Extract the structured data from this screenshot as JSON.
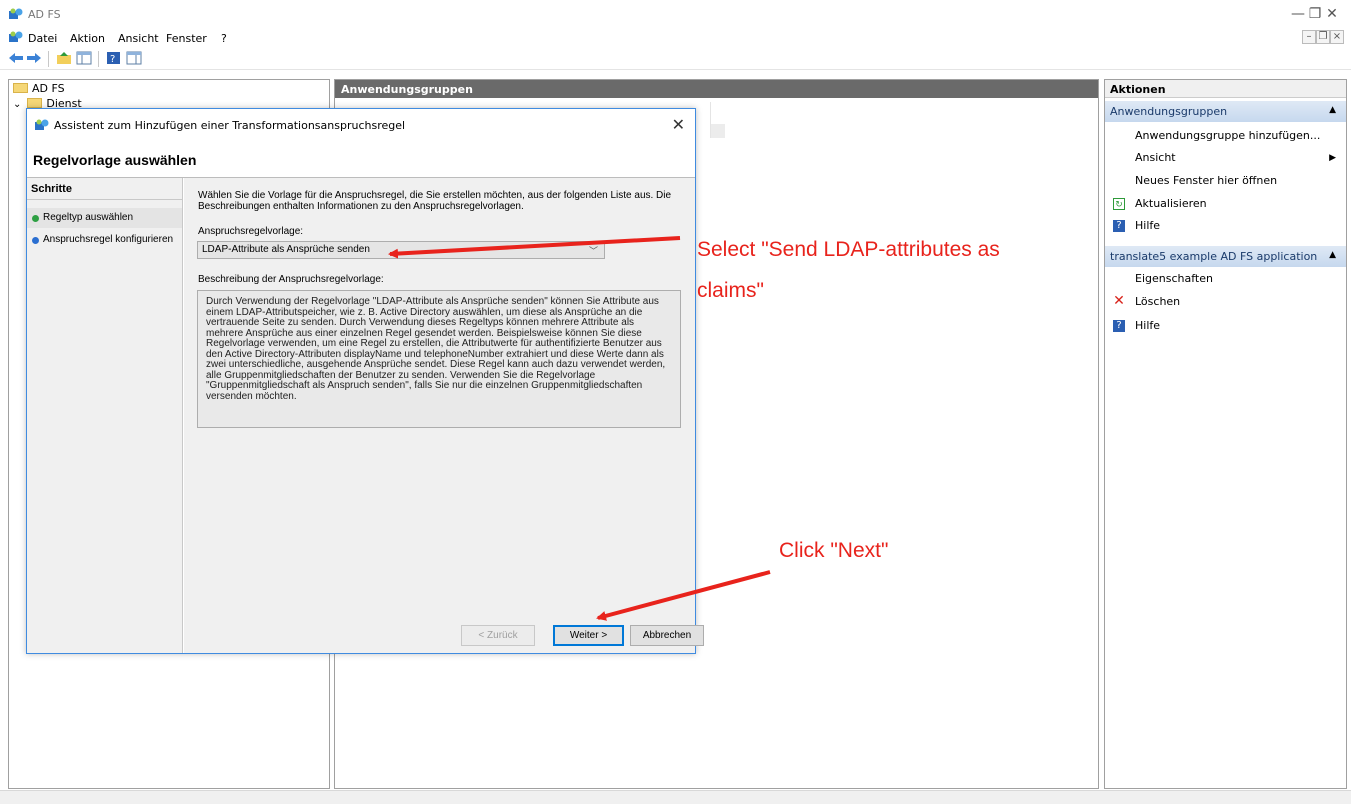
{
  "window": {
    "title": "AD FS"
  },
  "menu": {
    "items": [
      "Datei",
      "Aktion",
      "Ansicht",
      "Fenster",
      "?"
    ]
  },
  "tree": {
    "root": "AD FS",
    "child": "Dienst"
  },
  "middle": {
    "header": "Anwendungsgruppen"
  },
  "actions": {
    "title": "Aktionen",
    "section1": {
      "title": "Anwendungsgruppen",
      "items": [
        "Anwendungsgruppe hinzufügen...",
        "Ansicht",
        "Neues Fenster hier öffnen",
        "Aktualisieren",
        "Hilfe"
      ]
    },
    "section2": {
      "title": "translate5 example AD FS application",
      "items": [
        "Eigenschaften",
        "Löschen",
        "Hilfe"
      ]
    }
  },
  "dialog": {
    "title": "Assistent zum Hinzufügen einer Transformationsanspruchsregel",
    "heading": "Regelvorlage auswählen",
    "steps_title": "Schritte",
    "steps": [
      "Regeltyp auswählen",
      "Anspruchsregel konfigurieren"
    ],
    "intro": "Wählen Sie die Vorlage für die Anspruchsregel, die Sie erstellen möchten, aus der folgenden Liste aus. Die Beschreibungen enthalten Informationen zu den Anspruchsregelvorlagen.",
    "template_label": "Anspruchsregelvorlage:",
    "template_value": "LDAP-Attribute als Ansprüche senden",
    "description_label": "Beschreibung der Anspruchsregelvorlage:",
    "description": "Durch Verwendung der Regelvorlage \"LDAP-Attribute als Ansprüche senden\" können Sie Attribute aus einem LDAP-Attributspeicher, wie z. B. Active Directory auswählen, um diese als Ansprüche an die vertrauende Seite zu senden. Durch Verwendung dieses Regeltyps können mehrere Attribute als mehrere Ansprüche aus einer einzelnen Regel gesendet werden. Beispielsweise können Sie diese Regelvorlage verwenden, um eine Regel zu erstellen, die Attributwerte für authentifizierte Benutzer aus den Active Directory-Attributen displayName und telephoneNumber extrahiert und diese Werte dann als zwei unterschiedliche, ausgehende Ansprüche sendet. Diese Regel kann auch dazu verwendet werden, alle Gruppenmitgliedschaften der Benutzer zu senden. Verwenden Sie die Regelvorlage \"Gruppenmitgliedschaft als Anspruch senden\", falls Sie nur die einzelnen Gruppenmitgliedschaften versenden möchten.",
    "buttons": {
      "back": "< Zurück",
      "next": "Weiter >",
      "cancel": "Abbrechen"
    }
  },
  "annotations": {
    "select_line1": "Select \"Send LDAP-attributes as",
    "select_line2": "claims\"",
    "click_next": "Click \"Next\""
  },
  "colors": {
    "annotation": "#e8231c",
    "accent": "#0078d7",
    "pane_header": "#6a6a6a"
  }
}
